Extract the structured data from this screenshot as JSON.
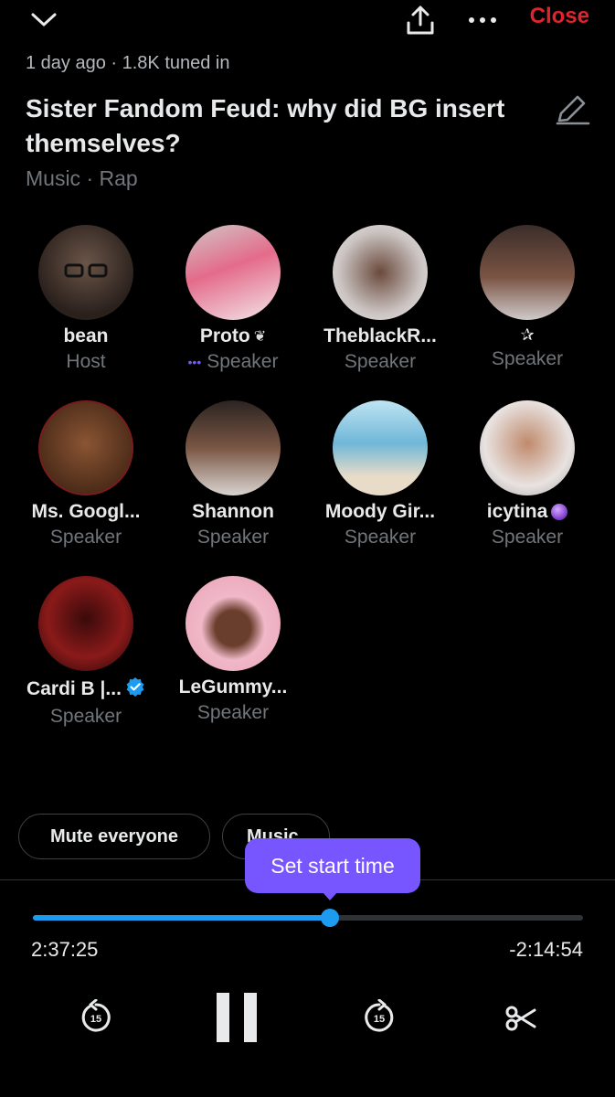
{
  "header": {
    "close_label": "Close",
    "meta": "1 day ago · 1.8K tuned in",
    "title": "Sister Fandom Feud: why did BG insert themselves?",
    "topics": "Music · Rap"
  },
  "participants": [
    {
      "name": "bean",
      "role": "Host",
      "avatar_color": "#4a3b33"
    },
    {
      "name": "Proto",
      "role": "Speaker",
      "avatar_color": "#e46b8a"
    },
    {
      "name": "TheblackR...",
      "role": "Speaker",
      "avatar_color": "#6b5a50"
    },
    {
      "name": "✰",
      "role": "Speaker",
      "avatar_color": "#6b4a3c"
    },
    {
      "name": "Ms. Googl...",
      "role": "Speaker",
      "avatar_color": "#7a4a2e"
    },
    {
      "name": "Shannon",
      "role": "Speaker",
      "avatar_color": "#6e4b3a"
    },
    {
      "name": "Moody Gir...",
      "role": "Speaker",
      "avatar_color": "#6fb7d8"
    },
    {
      "name": "icytina",
      "role": "Speaker",
      "avatar_color": "#d8c4b8"
    },
    {
      "name": "Cardi B |...",
      "role": "Speaker",
      "avatar_color": "#8b1a1a"
    },
    {
      "name": "LeGummy...",
      "role": "Speaker",
      "avatar_color": "#e9a3b5"
    }
  ],
  "actions": {
    "mute_everyone": "Mute everyone",
    "music": "Music"
  },
  "player": {
    "tooltip": "Set start time",
    "progress": 0.54,
    "elapsed": "2:37:25",
    "remaining": "-2:14:54",
    "rewind_label": "15",
    "forward_label": "15"
  },
  "colors": {
    "accent": "#1d9bf0",
    "close": "#e0242e",
    "tooltip": "#7856ff",
    "verified": "#1d9bf0"
  }
}
